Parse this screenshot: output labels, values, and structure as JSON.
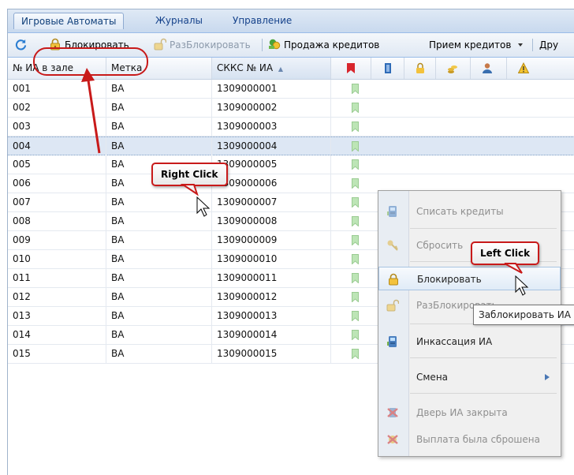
{
  "tabs": [
    {
      "label": "Игровые Автоматы",
      "active": true
    },
    {
      "label": "Журналы",
      "active": false
    },
    {
      "label": "Управление",
      "active": false
    }
  ],
  "toolbar": {
    "refresh_icon": "refresh-icon",
    "lock_label": "Блокировать",
    "unlock_label": "РазБлокировать",
    "sell_credits_label": "Продажа кредитов",
    "receive_credits_label": "Прием кредитов",
    "other_label": "Дру"
  },
  "grid": {
    "columns": [
      "№ ИА в зале",
      "Метка",
      "СККС № ИА"
    ],
    "sort_indicator": "▲",
    "icon_columns": [
      "bookmark-red-icon",
      "door-icon",
      "lock-icon",
      "coins-icon",
      "user-icon",
      "warning-icon"
    ],
    "rows": [
      {
        "num": "001",
        "tag": "ВА",
        "skks": "1309000001"
      },
      {
        "num": "002",
        "tag": "ВА",
        "skks": "1309000002"
      },
      {
        "num": "003",
        "tag": "ВА",
        "skks": "1309000003"
      },
      {
        "num": "004",
        "tag": "ВА",
        "skks": "1309000004",
        "selected": true
      },
      {
        "num": "005",
        "tag": "ВА",
        "skks": "1309000005"
      },
      {
        "num": "006",
        "tag": "ВА",
        "skks": "1309000006"
      },
      {
        "num": "007",
        "tag": "ВА",
        "skks": "1309000007"
      },
      {
        "num": "008",
        "tag": "ВА",
        "skks": "1309000008"
      },
      {
        "num": "009",
        "tag": "ВА",
        "skks": "1309000009"
      },
      {
        "num": "010",
        "tag": "ВА",
        "skks": "1309000010"
      },
      {
        "num": "011",
        "tag": "ВА",
        "skks": "1309000011"
      },
      {
        "num": "012",
        "tag": "ВА",
        "skks": "1309000012"
      },
      {
        "num": "013",
        "tag": "ВА",
        "skks": "1309000013"
      },
      {
        "num": "014",
        "tag": "ВА",
        "skks": "1309000014"
      },
      {
        "num": "015",
        "tag": "ВА",
        "skks": "1309000015"
      }
    ]
  },
  "context_menu": {
    "items": [
      {
        "label": "Списать кредиты",
        "icon": "machine-icon",
        "enabled": false
      },
      {
        "label": "Сбросить",
        "icon": "key-icon",
        "enabled": false
      },
      {
        "label": "Блокировать",
        "icon": "lock-icon",
        "enabled": true,
        "hover": true
      },
      {
        "label": "РазБлокировать",
        "icon": "unlock-icon",
        "enabled": false
      },
      {
        "label": "Инкассация ИА",
        "icon": "machine-icon",
        "enabled": true
      },
      {
        "label": "Смена",
        "icon": "",
        "enabled": true,
        "submenu": true
      },
      {
        "label": "Дверь ИА закрыта",
        "icon": "door-closed-icon",
        "enabled": false
      },
      {
        "label": "Выплата была сброшена",
        "icon": "payout-reset-icon",
        "enabled": false
      }
    ],
    "tooltip": "Заблокировать ИА"
  },
  "callouts": {
    "right_click": "Right Click",
    "left_click": "Left Click"
  },
  "colors": {
    "accent": "#c81a1a",
    "selected_row": "#dde7f4",
    "bookmark_green": "#bde5b6"
  }
}
